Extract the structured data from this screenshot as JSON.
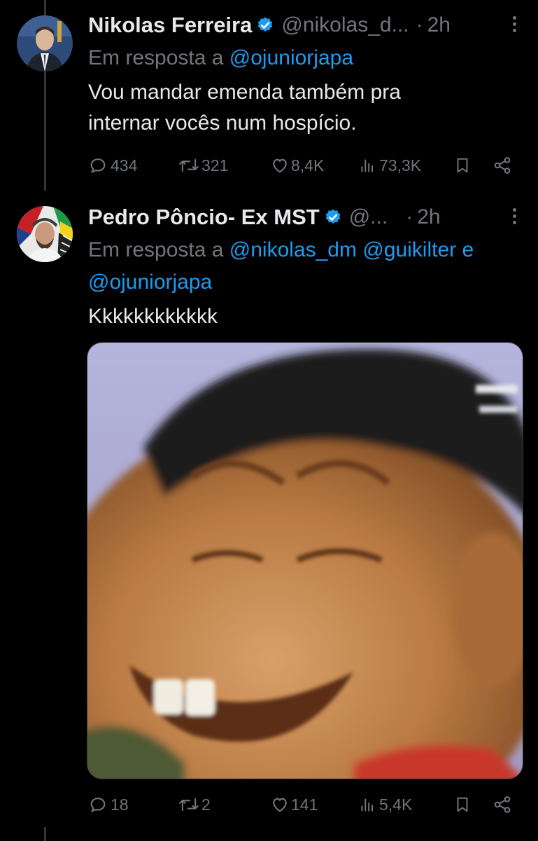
{
  "tweets": [
    {
      "name": "Nikolas Ferreira",
      "handle": "@nikolas_d...",
      "time": "2h",
      "reply_prefix": "Em resposta a",
      "reply_mentions": [
        "@ojuniorjapa"
      ],
      "text_lines": [
        "Vou mandar emenda também pra",
        "internar vocês num hospício."
      ],
      "stats": {
        "replies": "434",
        "retweets": "321",
        "likes": "8,4K",
        "views": "73,3K"
      }
    },
    {
      "name": "Pedro Pôncio- Ex MST",
      "handle": "@...",
      "time": "2h",
      "reply_prefix": "Em resposta a",
      "reply_mentions": [
        "@nikolas_dm",
        "@guikilter",
        "@ojuniorjapa"
      ],
      "reply_joiner": "e",
      "text": "Kkkkkkkkkkkk",
      "stats": {
        "replies": "18",
        "retweets": "2",
        "likes": "141",
        "views": "5,4K"
      }
    }
  ],
  "colors": {
    "background": "#000000",
    "text": "#e7e9ea",
    "muted": "#71767b",
    "link": "#1d9bf0",
    "verified": "#1d9bf0"
  },
  "icons": [
    "verified-badge-icon",
    "more-options-icon",
    "reply-icon",
    "retweet-icon",
    "like-icon",
    "views-icon",
    "bookmark-icon",
    "share-icon"
  ]
}
